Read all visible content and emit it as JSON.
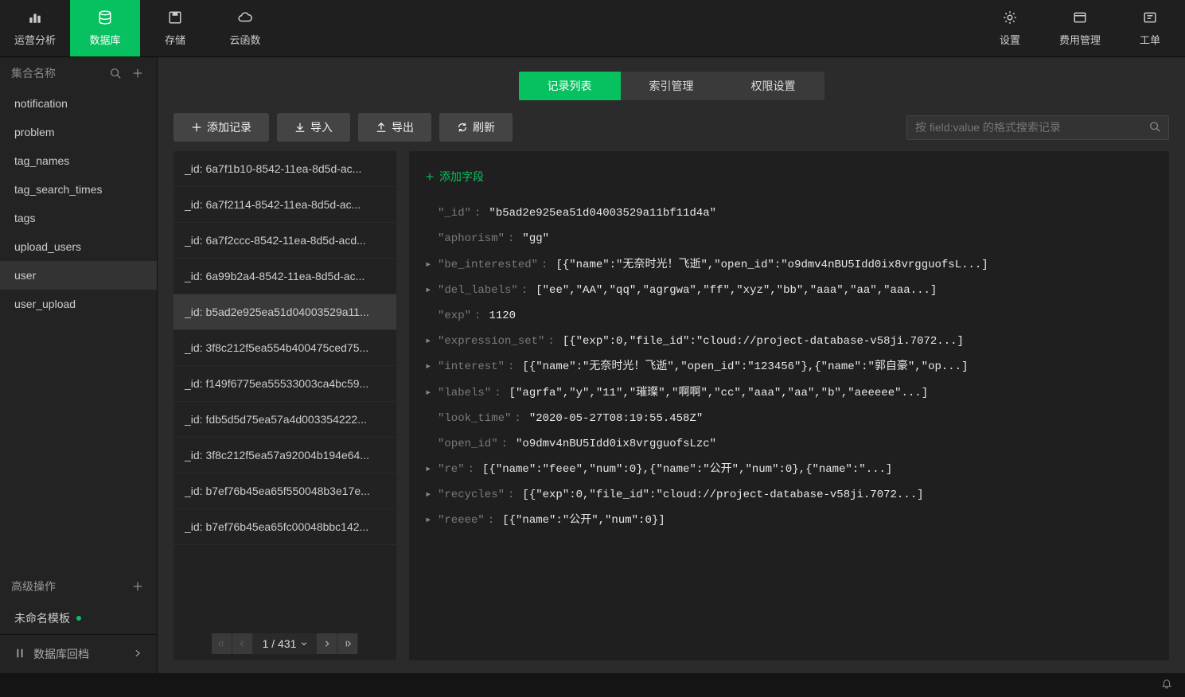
{
  "topnav": {
    "left": [
      {
        "id": "analytics",
        "label": "运营分析",
        "icon": "bar-chart"
      },
      {
        "id": "database",
        "label": "数据库",
        "icon": "database",
        "active": true
      },
      {
        "id": "storage",
        "label": "存储",
        "icon": "save"
      },
      {
        "id": "cloudfn",
        "label": "云函数",
        "icon": "cloud"
      }
    ],
    "right": [
      {
        "id": "settings",
        "label": "设置",
        "icon": "gear"
      },
      {
        "id": "billing",
        "label": "费用管理",
        "icon": "window"
      },
      {
        "id": "ticket",
        "label": "工单",
        "icon": "ticket"
      }
    ]
  },
  "sidebar": {
    "header_title": "集合名称",
    "collections": [
      {
        "name": "notification"
      },
      {
        "name": "problem"
      },
      {
        "name": "tag_names"
      },
      {
        "name": "tag_search_times"
      },
      {
        "name": "tags"
      },
      {
        "name": "upload_users"
      },
      {
        "name": "user",
        "selected": true
      },
      {
        "name": "user_upload"
      }
    ],
    "advanced_label": "高级操作",
    "template_label": "未命名模板",
    "footer_label": "数据库回档"
  },
  "tabs": [
    {
      "id": "records",
      "label": "记录列表",
      "active": true
    },
    {
      "id": "indexes",
      "label": "索引管理"
    },
    {
      "id": "permissions",
      "label": "权限设置"
    }
  ],
  "toolbar": {
    "add_record": "添加记录",
    "import": "导入",
    "export": "导出",
    "refresh": "刷新",
    "search_placeholder": "按 field:value 的格式搜索记录"
  },
  "records": [
    {
      "label": "_id: 6a7f1b10-8542-11ea-8d5d-ac..."
    },
    {
      "label": "_id: 6a7f2114-8542-11ea-8d5d-ac..."
    },
    {
      "label": "_id: 6a7f2ccc-8542-11ea-8d5d-acd..."
    },
    {
      "label": "_id: 6a99b2a4-8542-11ea-8d5d-ac..."
    },
    {
      "label": "_id: b5ad2e925ea51d04003529a11...",
      "selected": true
    },
    {
      "label": "_id: 3f8c212f5ea554b400475ced75..."
    },
    {
      "label": "_id: f149f6775ea55533003ca4bc59..."
    },
    {
      "label": "_id: fdb5d5d75ea57a4d003354222..."
    },
    {
      "label": "_id: 3f8c212f5ea57a92004b194e64..."
    },
    {
      "label": "_id: b7ef76b45ea65f550048b3e17e..."
    },
    {
      "label": "_id: b7ef76b45ea65fc00048bbc142..."
    }
  ],
  "pagination": {
    "info": "1 / 431"
  },
  "detail": {
    "add_field_label": "添加字段",
    "fields": [
      {
        "key": "\"_id\"",
        "value": "\"b5ad2e925ea51d04003529a11bf11d4a\"",
        "type": "str"
      },
      {
        "key": "\"aphorism\"",
        "value": "\"gg\"",
        "type": "str"
      },
      {
        "key": "\"be_interested\"",
        "value": "[{\"name\":\"无奈时光！飞逝\",\"open_id\":\"o9dmv4nBU5Idd0ix8vrgguofsL...]",
        "type": "arr",
        "expandable": true
      },
      {
        "key": "\"del_labels\"",
        "value": "[\"ee\",\"AA\",\"qq\",\"agrgwa\",\"ff\",\"xyz\",\"bb\",\"aaa\",\"aa\",\"aaa...]",
        "type": "arr",
        "expandable": true
      },
      {
        "key": "\"exp\"",
        "value": "1120",
        "type": "num"
      },
      {
        "key": "\"expression_set\"",
        "value": "[{\"exp\":0,\"file_id\":\"cloud://project-database-v58ji.7072...]",
        "type": "arr",
        "expandable": true
      },
      {
        "key": "\"interest\"",
        "value": "[{\"name\":\"无奈时光！飞逝\",\"open_id\":\"123456\"},{\"name\":\"郭自豪\",\"op...]",
        "type": "arr",
        "expandable": true
      },
      {
        "key": "\"labels\"",
        "value": "[\"agrfa\",\"y\",\"11\",\"璀璨\",\"啊啊\",\"cc\",\"aaa\",\"aa\",\"b\",\"aeeeee\"...]",
        "type": "arr",
        "expandable": true
      },
      {
        "key": "\"look_time\"",
        "value": "\"2020-05-27T08:19:55.458Z\"",
        "type": "str"
      },
      {
        "key": "\"open_id\"",
        "value": "\"o9dmv4nBU5Idd0ix8vrgguofsLzc\"",
        "type": "str"
      },
      {
        "key": "\"re\"",
        "value": "[{\"name\":\"feee\",\"num\":0},{\"name\":\"公开\",\"num\":0},{\"name\":\"...]",
        "type": "arr",
        "expandable": true
      },
      {
        "key": "\"recycles\"",
        "value": "[{\"exp\":0,\"file_id\":\"cloud://project-database-v58ji.7072...]",
        "type": "arr",
        "expandable": true
      },
      {
        "key": "\"reeee\"",
        "value": "[{\"name\":\"公开\",\"num\":0}]",
        "type": "arr",
        "expandable": true
      }
    ]
  }
}
